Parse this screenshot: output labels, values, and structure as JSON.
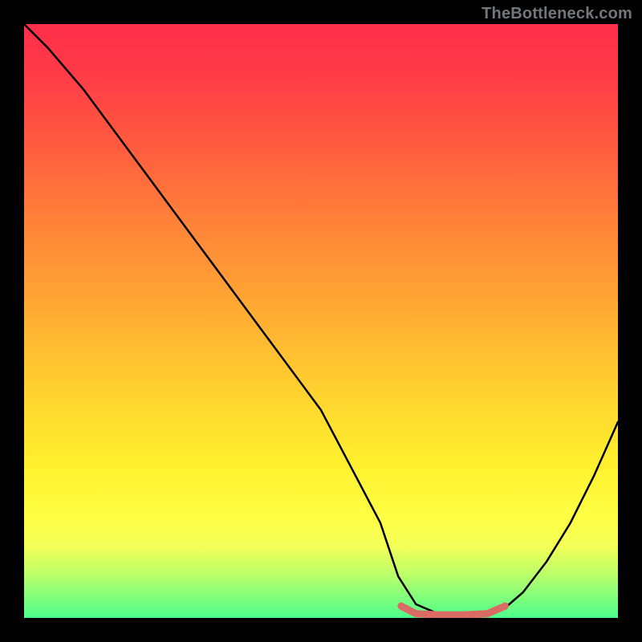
{
  "attribution": "TheBottleneck.com",
  "chart_data": {
    "type": "line",
    "title": "",
    "xlabel": "",
    "ylabel": "",
    "xlim": [
      0,
      100
    ],
    "ylim": [
      0,
      100
    ],
    "series": [
      {
        "name": "curve",
        "x": [
          0,
          4,
          10,
          20,
          30,
          40,
          50,
          60,
          63,
          66,
          70,
          74,
          78,
          81,
          84,
          88,
          92,
          96,
          100
        ],
        "y": [
          100,
          96,
          89,
          75.5,
          62,
          48.5,
          35,
          16,
          7,
          2.3,
          0.6,
          0.4,
          0.6,
          1.7,
          4.3,
          9.5,
          16,
          24,
          33
        ]
      }
    ],
    "highlight": {
      "name": "bottleneck-band",
      "color": "#d96a64",
      "x": [
        63.5,
        66,
        70,
        74,
        78,
        81
      ],
      "y": [
        2.0,
        0.7,
        0.5,
        0.5,
        0.7,
        2.0
      ]
    },
    "colors": {
      "curve": "#000000",
      "highlight": "#d96a64",
      "background_top": "#ff2f4a",
      "background_bottom": "#4cff8c",
      "frame": "#000000"
    }
  }
}
